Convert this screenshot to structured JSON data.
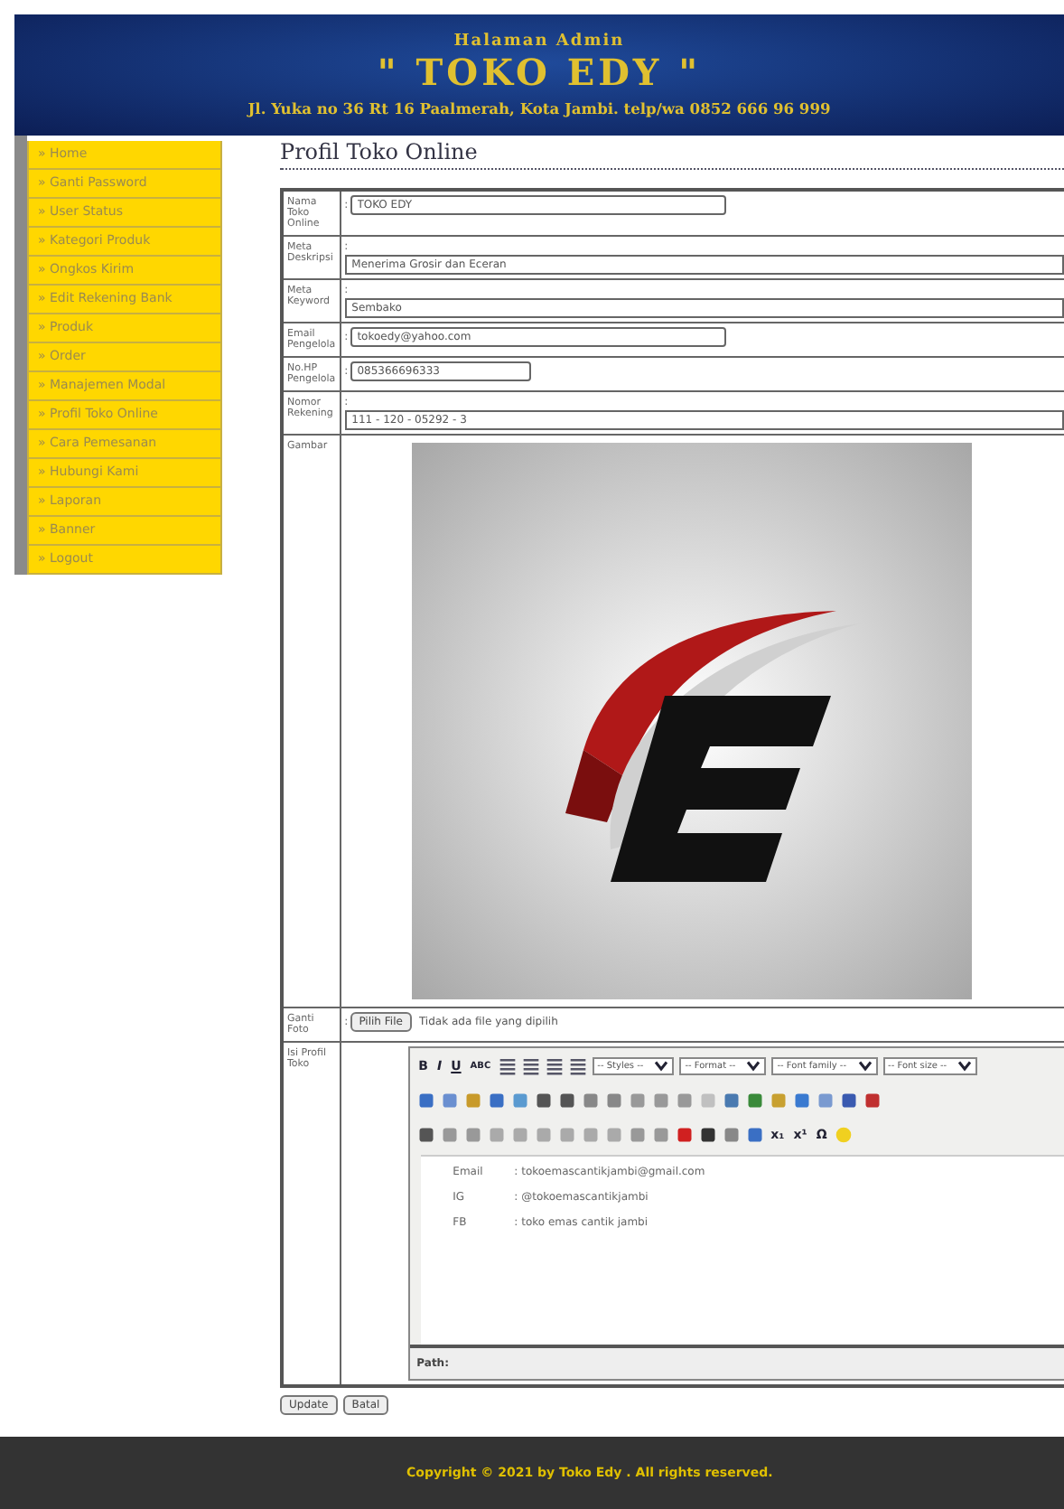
{
  "header": {
    "subtitle": "Halaman Admin",
    "title": "\" TOKO EDY \"",
    "address": "Jl. Yuka no 36 Rt 16 Paalmerah, Kota Jambi. telp/wa 0852 666 96 999"
  },
  "sidebar": {
    "items": [
      {
        "label": "» Home"
      },
      {
        "label": "» Ganti Password"
      },
      {
        "label": "» User Status"
      },
      {
        "label": "» Kategori Produk"
      },
      {
        "label": "» Ongkos Kirim"
      },
      {
        "label": "» Edit Rekening Bank"
      },
      {
        "label": "» Produk"
      },
      {
        "label": "» Order"
      },
      {
        "label": "» Manajemen Modal"
      },
      {
        "label": "» Profil Toko Online"
      },
      {
        "label": "» Cara Pemesanan"
      },
      {
        "label": "» Hubungi Kami"
      },
      {
        "label": "» Laporan"
      },
      {
        "label": "» Banner"
      },
      {
        "label": "» Logout"
      }
    ]
  },
  "page_title": "Profil Toko Online",
  "form": {
    "fields": [
      {
        "kind": "short",
        "label": "Nama Toko Online",
        "separator": ":",
        "value": "TOKO EDY"
      },
      {
        "kind": "wide",
        "label": "Meta Deskripsi",
        "separator": ":",
        "value": "Menerima Grosir dan Eceran"
      },
      {
        "kind": "wide",
        "label": "Meta Keyword",
        "separator": ":",
        "value": "Sembako"
      },
      {
        "kind": "short",
        "label": "Email Pengelola",
        "separator": ":",
        "value": "tokoedy@yahoo.com"
      },
      {
        "kind": "tiny",
        "label": "No.HP Pengelola",
        "separator": ":",
        "value": "085366696333"
      },
      {
        "kind": "wide",
        "label": "Nomor Rekening",
        "separator": ":",
        "value": "111 - 120 - 05292 - 3"
      }
    ],
    "image_label": "Gambar",
    "photo": {
      "label": "Ganti Foto",
      "separator": ":",
      "button": "Pilih File",
      "status": "Tidak ada file yang dipilih"
    },
    "editor": {
      "label": "Isi Profil Toko",
      "format_buttons": [
        "B",
        "I",
        "U",
        "ABC"
      ],
      "selects": [
        "-- Styles --",
        "-- Format --",
        "-- Font family --",
        "-- Font size --"
      ],
      "symbols": [
        "x₁",
        "x¹",
        "Ω"
      ],
      "lines": [
        {
          "key": "Email",
          "value": ": tokoemascantikjambi@gmail.com"
        },
        {
          "key": "IG",
          "value": ": @tokoemascantikjambi"
        },
        {
          "key": "FB",
          "value": ": toko emas cantik jambi"
        }
      ],
      "path_label": "Path:"
    },
    "buttons": [
      "Update",
      "Batal"
    ]
  },
  "footer": "Copyright © 2021 by Toko Edy . All rights reserved."
}
